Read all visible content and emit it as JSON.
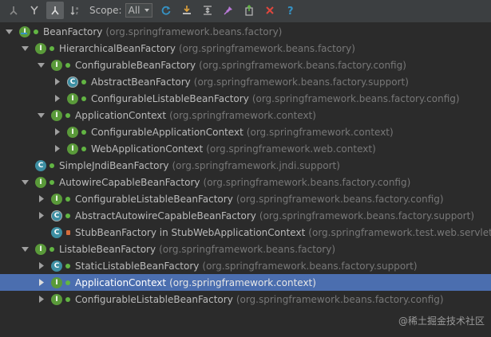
{
  "toolbar": {
    "scope_label": "Scope:",
    "scope_value": "All"
  },
  "tree": [
    {
      "name": "BeanFactory",
      "pkg": "(org.springframework.beans.factory)",
      "kind": "iface",
      "depth": 0,
      "state": "open"
    },
    {
      "name": "HierarchicalBeanFactory",
      "pkg": "(org.springframework.beans.factory)",
      "kind": "iface",
      "depth": 1,
      "state": "open"
    },
    {
      "name": "ConfigurableBeanFactory",
      "pkg": "(org.springframework.beans.factory.config)",
      "kind": "iface",
      "depth": 2,
      "state": "open"
    },
    {
      "name": "AbstractBeanFactory",
      "pkg": "(org.springframework.beans.factory.support)",
      "kind": "abs",
      "depth": 3,
      "state": "closed"
    },
    {
      "name": "ConfigurableListableBeanFactory",
      "pkg": "(org.springframework.beans.factory.config)",
      "kind": "iface",
      "depth": 3,
      "state": "closed"
    },
    {
      "name": "ApplicationContext",
      "pkg": "(org.springframework.context)",
      "kind": "iface",
      "depth": 2,
      "state": "open"
    },
    {
      "name": "ConfigurableApplicationContext",
      "pkg": "(org.springframework.context)",
      "kind": "iface",
      "depth": 3,
      "state": "closed"
    },
    {
      "name": "WebApplicationContext",
      "pkg": "(org.springframework.web.context)",
      "kind": "iface",
      "depth": 3,
      "state": "closed"
    },
    {
      "name": "SimpleJndiBeanFactory",
      "pkg": "(org.springframework.jndi.support)",
      "kind": "cls",
      "depth": 1,
      "state": "none"
    },
    {
      "name": "AutowireCapableBeanFactory",
      "pkg": "(org.springframework.beans.factory.config)",
      "kind": "iface",
      "depth": 1,
      "state": "open"
    },
    {
      "name": "ConfigurableListableBeanFactory",
      "pkg": "(org.springframework.beans.factory.config)",
      "kind": "iface",
      "depth": 2,
      "state": "closed"
    },
    {
      "name": "AbstractAutowireCapableBeanFactory",
      "pkg": "(org.springframework.beans.factory.support)",
      "kind": "abs",
      "depth": 2,
      "state": "closed"
    },
    {
      "name": "StubBeanFactory in StubWebApplicationContext",
      "pkg": "(org.springframework.test.web.servlet.se",
      "kind": "cls",
      "depth": 2,
      "state": "none",
      "vis": "lock"
    },
    {
      "name": "ListableBeanFactory",
      "pkg": "(org.springframework.beans.factory)",
      "kind": "iface",
      "depth": 1,
      "state": "open"
    },
    {
      "name": "StaticListableBeanFactory",
      "pkg": "(org.springframework.beans.factory.support)",
      "kind": "cls",
      "depth": 2,
      "state": "closed"
    },
    {
      "name": "ApplicationContext",
      "pkg": "(org.springframework.context)",
      "kind": "iface",
      "depth": 2,
      "state": "closed",
      "selected": true
    },
    {
      "name": "ConfigurableListableBeanFactory",
      "pkg": "(org.springframework.beans.factory.config)",
      "kind": "iface",
      "depth": 2,
      "state": "closed"
    }
  ],
  "watermark": "@稀土掘金技术社区"
}
